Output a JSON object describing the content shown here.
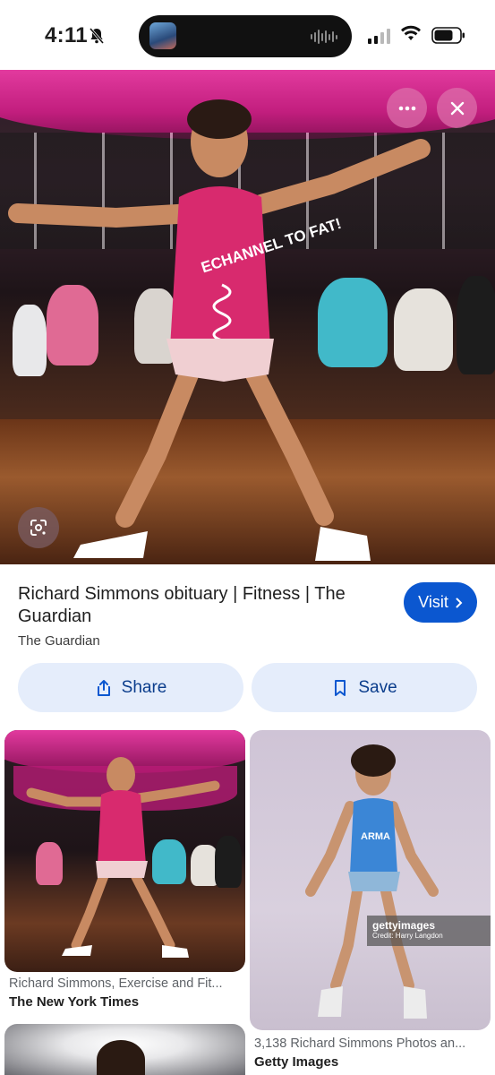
{
  "status": {
    "time": "4:11",
    "colors": {
      "text": "#111111",
      "island": "#111111"
    }
  },
  "hero": {
    "menu_icon": "more-horiz-icon",
    "close_icon": "close-icon",
    "lens_icon": "lens-icon",
    "shirt_text": "ECHANNEL TO FAT!"
  },
  "result": {
    "title": "Richard Simmons obituary | Fitness | The Guardian",
    "source": "The Guardian",
    "visit_label": "Visit",
    "share_label": "Share",
    "save_label": "Save",
    "accent": "#0b57d0"
  },
  "grid": {
    "items": [
      {
        "caption": "Richard Simmons, Exercise and Fit...",
        "source": "The New York Times"
      },
      {
        "caption": "3,138 Richard Simmons Photos an...",
        "source": "Getty Images",
        "watermark": "gettyimages",
        "credit": "Credit: Harry Langdon",
        "tank_text": "ARMA"
      }
    ]
  }
}
